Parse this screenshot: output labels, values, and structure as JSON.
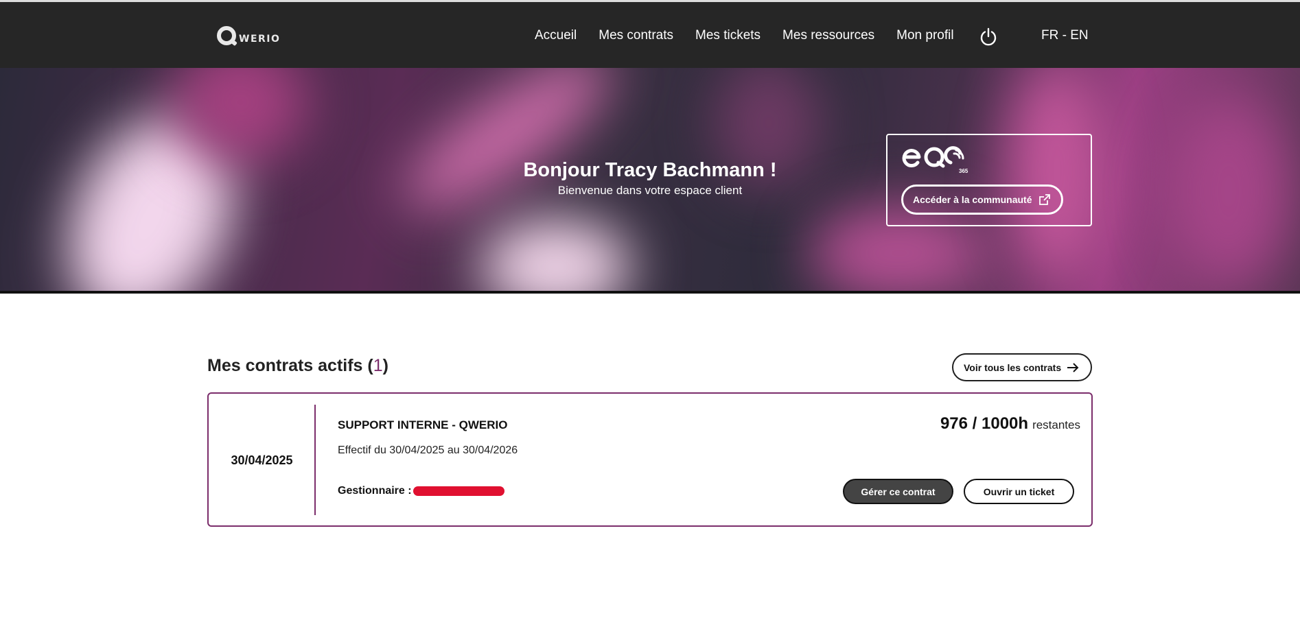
{
  "brand": {
    "logo_text": "WERIO"
  },
  "nav": {
    "items": [
      {
        "label": "Accueil"
      },
      {
        "label": "Mes contrats"
      },
      {
        "label": "Mes tickets"
      },
      {
        "label": "Mes ressources"
      },
      {
        "label": "Mon profil"
      }
    ],
    "power_icon": "power-icon",
    "lang_fr": "FR",
    "lang_sep": " - ",
    "lang_en": "EN"
  },
  "hero": {
    "title": "Bonjour Tracy Bachmann !",
    "subtitle": "Bienvenue dans votre espace client",
    "eqo": {
      "logo_icon": "eqo-365-logo",
      "button_label": "Accéder à la communauté",
      "button_icon": "external-link-icon"
    }
  },
  "contracts": {
    "title": "Mes contrats actifs",
    "count_open": "(",
    "count": "1",
    "count_close": ")",
    "view_all_label": "Voir tous les contrats",
    "view_all_icon": "arrow-right-icon",
    "items": [
      {
        "date": "30/04/2025",
        "name": "SUPPORT INTERNE - QWERIO",
        "period": "Effectif du 30/04/2025 au 30/04/2026",
        "manager_label": "Gestionnaire :",
        "hours": "976 /  1000h",
        "hours_label": "restantes",
        "manage_label": "Gérer ce contrat",
        "ticket_label": "Ouvrir un ticket"
      }
    ]
  },
  "colors": {
    "navbar": "#262626",
    "accent": "#7b2d6b",
    "redaction": "#e01030"
  }
}
